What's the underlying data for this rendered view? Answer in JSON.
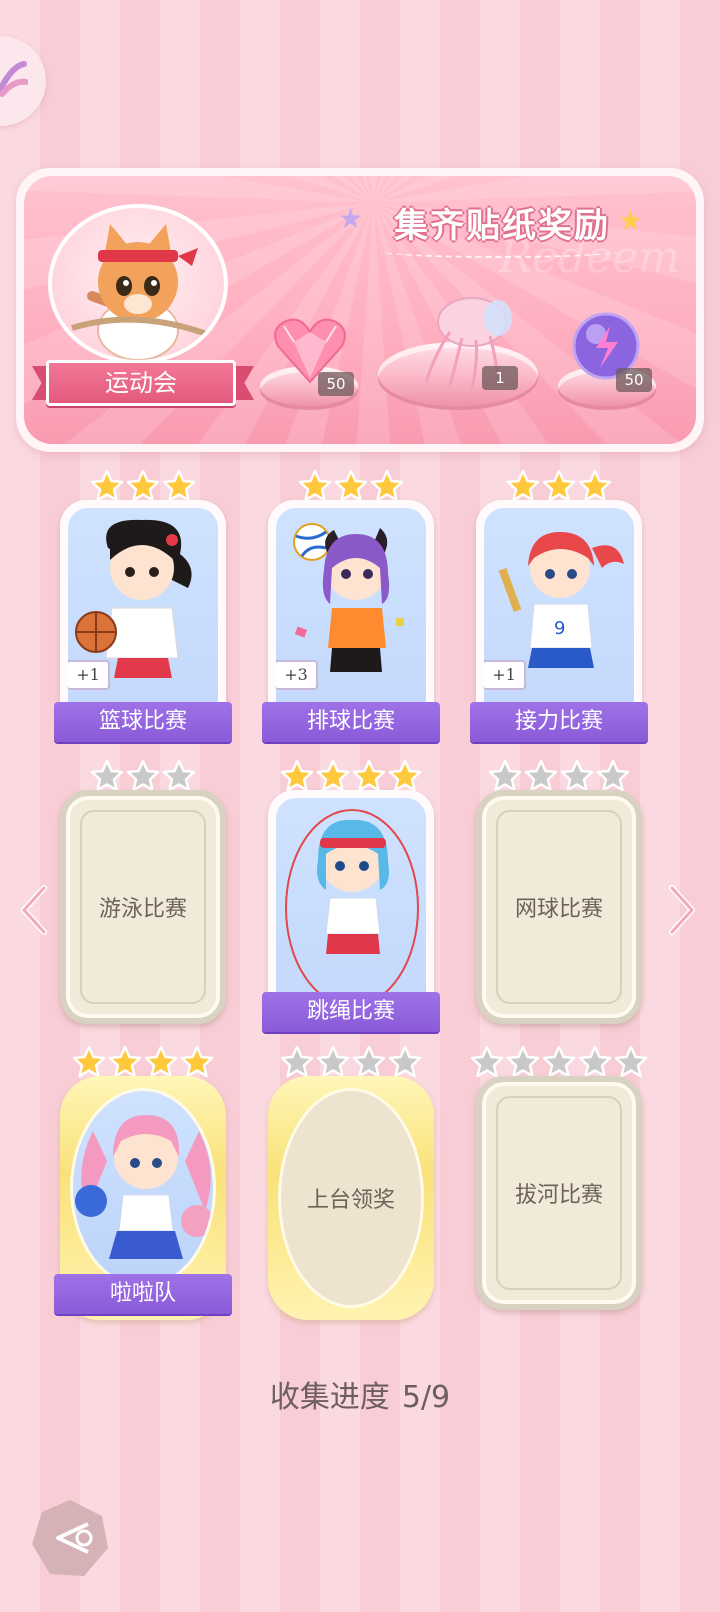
{
  "banner": {
    "title": "集齐贴纸奖励",
    "watermark": "Redeem",
    "event_name": "运动会",
    "rewards": [
      {
        "icon": "pink-heart-gem-icon",
        "count": "50"
      },
      {
        "icon": "jellyfish-decoration-icon",
        "count": "1"
      },
      {
        "icon": "purple-energy-orb-icon",
        "count": "50"
      }
    ]
  },
  "stickers": [
    {
      "label": "篮球比赛",
      "stars_filled": 3,
      "stars_total": 3,
      "collected": true,
      "extra": "+1",
      "art": "basketball-girl"
    },
    {
      "label": "排球比赛",
      "stars_filled": 3,
      "stars_total": 3,
      "collected": true,
      "extra": "+3",
      "art": "volleyball-girl"
    },
    {
      "label": "接力比赛",
      "stars_filled": 3,
      "stars_total": 3,
      "collected": true,
      "extra": "+1",
      "art": "relay-girl"
    },
    {
      "label": "游泳比赛",
      "stars_filled": 0,
      "stars_total": 3,
      "collected": false
    },
    {
      "label": "跳绳比赛",
      "stars_filled": 4,
      "stars_total": 4,
      "collected": true,
      "art": "jump-rope-girl"
    },
    {
      "label": "网球比赛",
      "stars_filled": 0,
      "stars_total": 4,
      "collected": false
    },
    {
      "label": "啦啦队",
      "stars_filled": 4,
      "stars_total": 4,
      "collected": true,
      "art": "cheerleader-girl"
    },
    {
      "label": "上台领奖",
      "stars_filled": 0,
      "stars_total": 4,
      "collected": false
    },
    {
      "label": "拔河比赛",
      "stars_filled": 0,
      "stars_total": 5,
      "collected": false
    }
  ],
  "progress": {
    "label": "收集进度",
    "value": "5/9"
  },
  "colors": {
    "gold_star": "#ffc83d",
    "grey_star": "#c9c9c9",
    "label_purple": "#8f60dd",
    "banner_pink": "#ffb0c1"
  }
}
